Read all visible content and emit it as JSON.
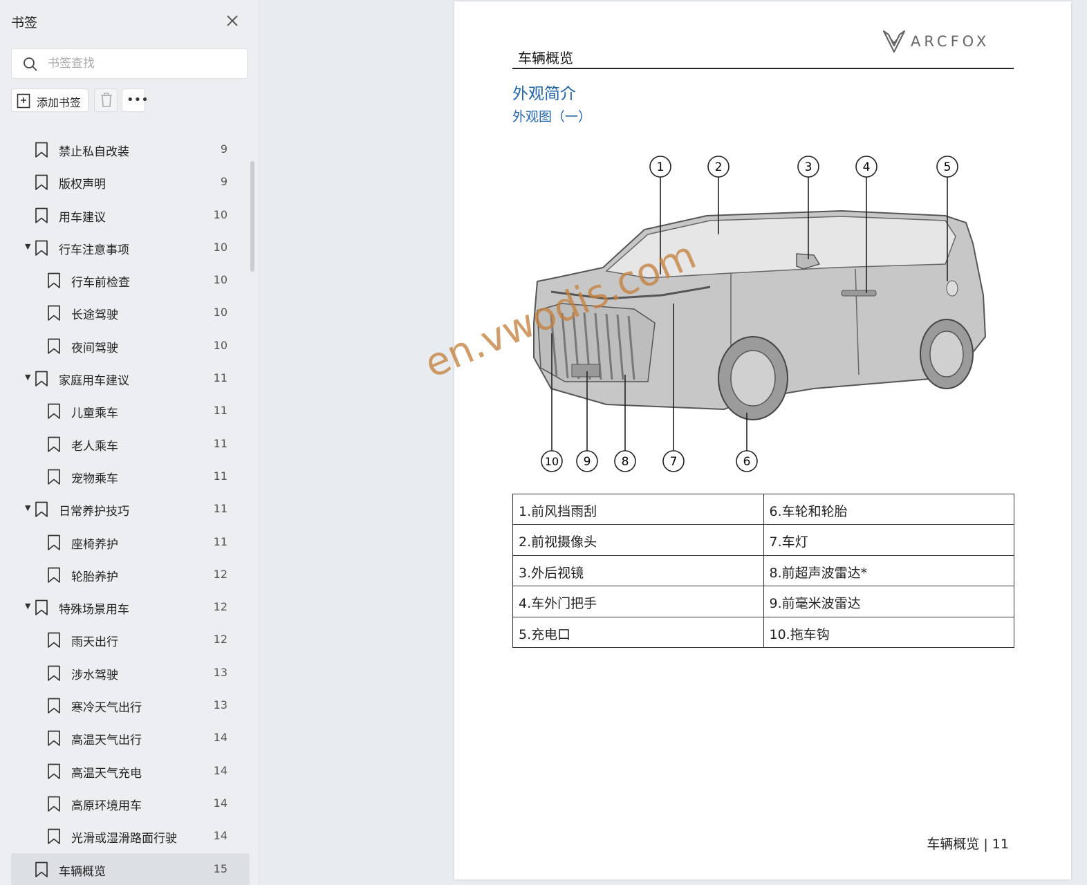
{
  "sidebar": {
    "title": "书签",
    "search_placeholder": "书签查找",
    "add_label": "添加书签",
    "items": [
      {
        "label": "禁止私自改装",
        "page": "9",
        "level": 1,
        "expanded": false
      },
      {
        "label": "版权声明",
        "page": "9",
        "level": 1,
        "expanded": false
      },
      {
        "label": "用车建议",
        "page": "10",
        "level": 1,
        "expanded": false
      },
      {
        "label": "行车注意事项",
        "page": "10",
        "level": 1,
        "expanded": true
      },
      {
        "label": "行车前检查",
        "page": "10",
        "level": 2,
        "expanded": false
      },
      {
        "label": "长途驾驶",
        "page": "10",
        "level": 2,
        "expanded": false
      },
      {
        "label": "夜间驾驶",
        "page": "10",
        "level": 2,
        "expanded": false
      },
      {
        "label": "家庭用车建议",
        "page": "11",
        "level": 1,
        "expanded": true
      },
      {
        "label": "儿童乘车",
        "page": "11",
        "level": 2,
        "expanded": false
      },
      {
        "label": "老人乘车",
        "page": "11",
        "level": 2,
        "expanded": false
      },
      {
        "label": "宠物乘车",
        "page": "11",
        "level": 2,
        "expanded": false
      },
      {
        "label": "日常养护技巧",
        "page": "11",
        "level": 1,
        "expanded": true
      },
      {
        "label": "座椅养护",
        "page": "11",
        "level": 2,
        "expanded": false
      },
      {
        "label": "轮胎养护",
        "page": "12",
        "level": 2,
        "expanded": false
      },
      {
        "label": "特殊场景用车",
        "page": "12",
        "level": 1,
        "expanded": true
      },
      {
        "label": "雨天出行",
        "page": "12",
        "level": 2,
        "expanded": false
      },
      {
        "label": "涉水驾驶",
        "page": "13",
        "level": 2,
        "expanded": false
      },
      {
        "label": "寒冷天气出行",
        "page": "13",
        "level": 2,
        "expanded": false
      },
      {
        "label": "高温天气出行",
        "page": "14",
        "level": 2,
        "expanded": false
      },
      {
        "label": "高温天气充电",
        "page": "14",
        "level": 2,
        "expanded": false
      },
      {
        "label": "高原环境用车",
        "page": "14",
        "level": 2,
        "expanded": false
      },
      {
        "label": "光滑或湿滑路面行驶",
        "page": "14",
        "level": 2,
        "expanded": false
      },
      {
        "label": "车辆概览",
        "page": "15",
        "level": 1,
        "expanded": false,
        "active": true
      }
    ]
  },
  "doc": {
    "brand": "ARCFOX",
    "header": "车辆概览",
    "section_title": "外观简介",
    "subsection_title": "外观图（一）",
    "callouts_top": [
      "1",
      "2",
      "3",
      "4",
      "5"
    ],
    "callouts_bottom": [
      "10",
      "9",
      "8",
      "7",
      "6"
    ],
    "watermark": "en.vwodis.com",
    "parts_table": [
      [
        "1.前风挡雨刮",
        "6.车轮和轮胎"
      ],
      [
        "2.前视摄像头",
        "7.车灯"
      ],
      [
        "3.外后视镜",
        "8.前超声波雷达*"
      ],
      [
        "4.车外门把手",
        "9.前毫米波雷达"
      ],
      [
        "5.充电口",
        "10.拖车钩"
      ]
    ],
    "footer": "车辆概览 | 11"
  },
  "colors": {
    "accent_blue": "#1f63ad",
    "watermark": "#c4803c",
    "sidebar_bg": "#eceef2",
    "active_item_bg": "#dcdfe4"
  }
}
